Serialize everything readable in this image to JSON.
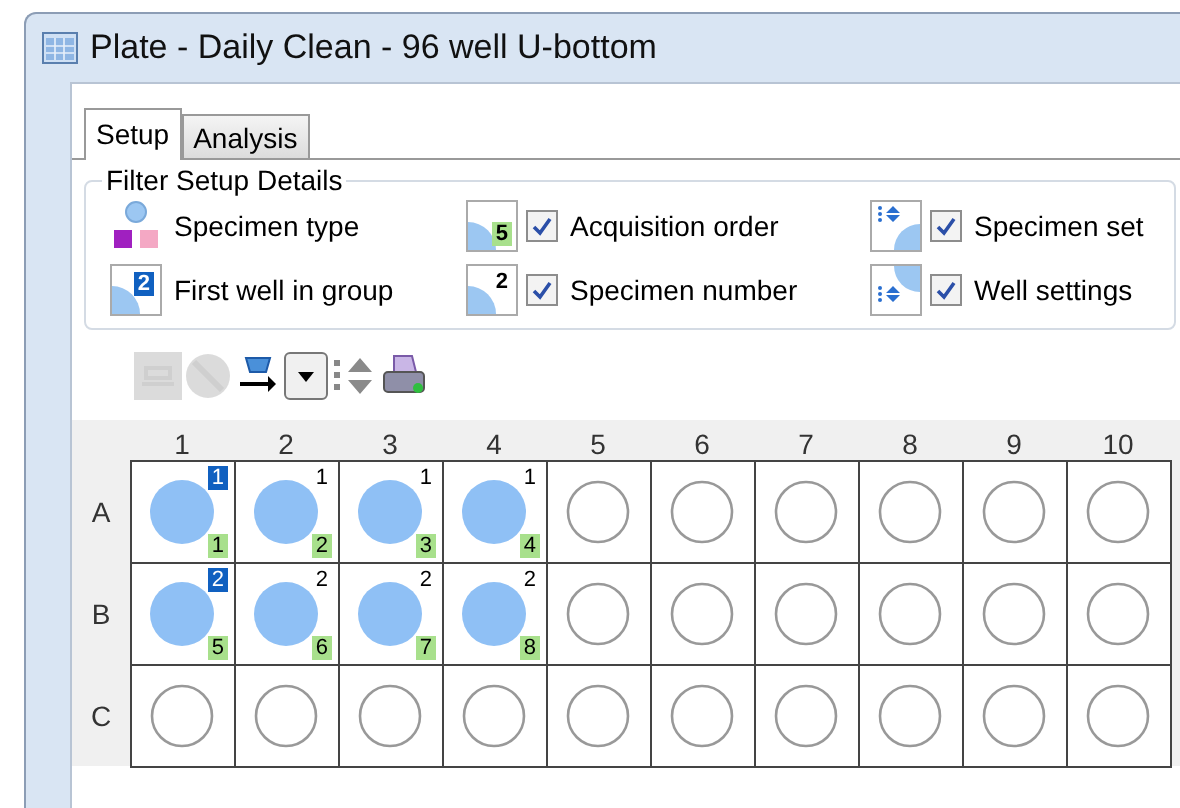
{
  "window": {
    "title": "Plate - Daily Clean - 96 well U-bottom"
  },
  "tabs": [
    {
      "label": "Setup",
      "selected": true
    },
    {
      "label": "Analysis",
      "selected": false
    }
  ],
  "filter": {
    "title": "Filter Setup Details",
    "items": [
      {
        "kind": "specimen-type",
        "label": "Specimen type"
      },
      {
        "kind": "acquisition-order",
        "label": "Acquisition order",
        "icon_text": "5",
        "checked": true
      },
      {
        "kind": "specimen-set",
        "label": "Specimen set",
        "checked": true
      },
      {
        "kind": "first-well",
        "label": "First well in group",
        "icon_text": "2"
      },
      {
        "kind": "specimen-number",
        "label": "Specimen number",
        "icon_text": "2",
        "checked": true
      },
      {
        "kind": "well-settings",
        "label": "Well settings",
        "checked": true
      }
    ]
  },
  "toolbar": [
    {
      "kind": "plate",
      "disabled": true
    },
    {
      "kind": "stop",
      "disabled": true
    },
    {
      "kind": "export",
      "disabled": false
    },
    {
      "kind": "dropdown",
      "disabled": false
    },
    {
      "kind": "sort",
      "disabled": false
    },
    {
      "kind": "print",
      "disabled": false
    }
  ],
  "plate": {
    "columns": [
      "1",
      "2",
      "3",
      "4",
      "5",
      "6",
      "7",
      "8",
      "9",
      "10"
    ],
    "rows": [
      {
        "label": "A",
        "wells": [
          {
            "filled": true,
            "group": "1",
            "first": true,
            "order": "1"
          },
          {
            "filled": true,
            "group": "1",
            "first": false,
            "order": "2"
          },
          {
            "filled": true,
            "group": "1",
            "first": false,
            "order": "3"
          },
          {
            "filled": true,
            "group": "1",
            "first": false,
            "order": "4"
          },
          {
            "filled": false
          },
          {
            "filled": false
          },
          {
            "filled": false
          },
          {
            "filled": false
          },
          {
            "filled": false
          },
          {
            "filled": false
          }
        ]
      },
      {
        "label": "B",
        "wells": [
          {
            "filled": true,
            "group": "2",
            "first": true,
            "order": "5"
          },
          {
            "filled": true,
            "group": "2",
            "first": false,
            "order": "6"
          },
          {
            "filled": true,
            "group": "2",
            "first": false,
            "order": "7"
          },
          {
            "filled": true,
            "group": "2",
            "first": false,
            "order": "8"
          },
          {
            "filled": false
          },
          {
            "filled": false
          },
          {
            "filled": false
          },
          {
            "filled": false
          },
          {
            "filled": false
          },
          {
            "filled": false
          }
        ]
      },
      {
        "label": "C",
        "wells": [
          {
            "filled": false
          },
          {
            "filled": false
          },
          {
            "filled": false
          },
          {
            "filled": false
          },
          {
            "filled": false
          },
          {
            "filled": false
          },
          {
            "filled": false
          },
          {
            "filled": false
          },
          {
            "filled": false
          },
          {
            "filled": false
          }
        ]
      }
    ]
  }
}
